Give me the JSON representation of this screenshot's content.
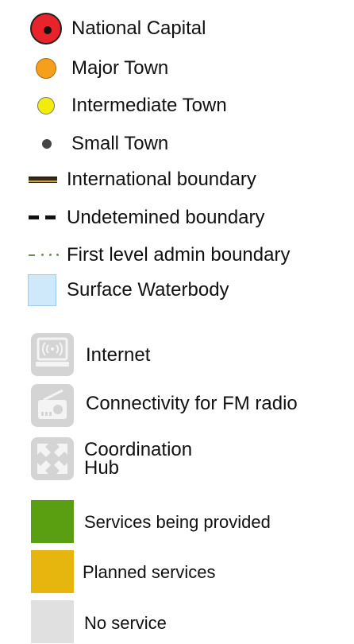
{
  "legend": {
    "national_capital": "National Capital",
    "major_town": "Major Town",
    "intermediate_town": "Intermediate Town",
    "small_town": "Small Town",
    "international_boundary": "International boundary",
    "undetermined_boundary": "Undetemined boundary",
    "first_level_admin_boundary": "First level admin boundary",
    "surface_waterbody": "Surface Waterbody",
    "internet": "Internet",
    "fm_radio": "Connectivity for FM radio",
    "coordination_hub_line1": "Coordination",
    "coordination_hub_line2": "Hub",
    "services_provided": "Services being provided",
    "planned_services": "Planned services",
    "no_service": "No service"
  },
  "colors": {
    "national_capital": "#e8242a",
    "major_town": "#f59f1c",
    "intermediate_town": "#f2ec0a",
    "small_town": "#444444",
    "surface_waterbody": "#cfe9fb",
    "icon_tile": "#d4d4d4",
    "services_provided": "#5a9e12",
    "planned_services": "#e6b50e",
    "no_service": "#e0e0e0"
  },
  "icons": {
    "internet": "internet-icon",
    "fm_radio": "radio-icon",
    "coordination_hub": "coordination-hub-icon"
  }
}
